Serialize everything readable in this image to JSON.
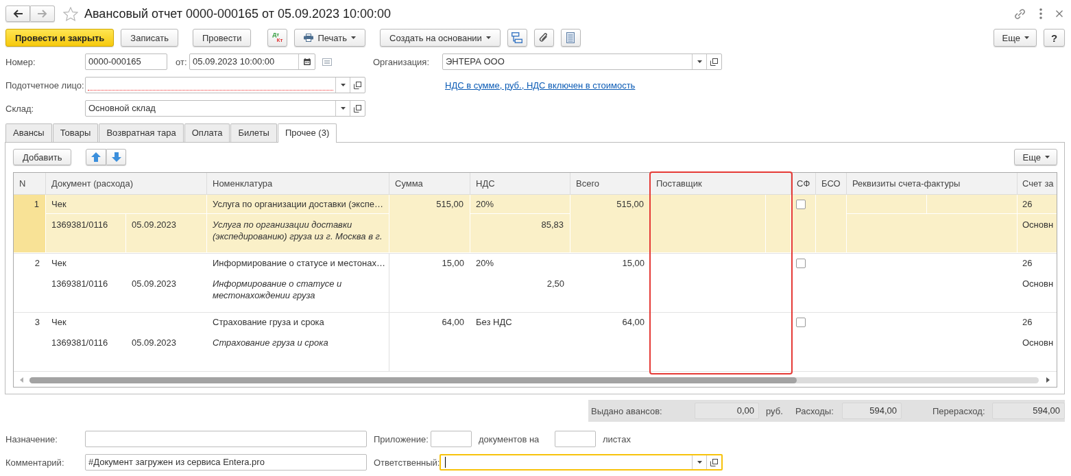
{
  "window": {
    "title": "Авансовый отчет 0000-000165 от 05.09.2023 10:00:00",
    "favorite": false
  },
  "navigation": {
    "can_go_back": true,
    "can_go_forward": false
  },
  "toolbar": {
    "post_and_close": "Провести и закрыть",
    "save": "Записать",
    "post": "Провести",
    "journal": {
      "debit": "Дт",
      "credit": "Кт"
    },
    "print": "Печать",
    "create_based_on": "Создать на основании",
    "more": "Еще",
    "help": "?"
  },
  "form": {
    "number": {
      "label": "Номер:",
      "value": "0000-000165"
    },
    "date": {
      "label": "от:",
      "value": "05.09.2023 10:00:00"
    },
    "organization": {
      "label": "Организация:",
      "value": "ЭНТЕРА ООО"
    },
    "accountable_person": {
      "label": "Подотчетное лицо:",
      "required": true
    },
    "vat_link": "НДС в сумме, руб., НДС включен в стоимость",
    "warehouse": {
      "label": "Склад:",
      "value": "Основной склад"
    }
  },
  "tabs": [
    {
      "label": "Авансы",
      "selected": false
    },
    {
      "label": "Товары",
      "selected": false
    },
    {
      "label": "Возвратная тара",
      "selected": false
    },
    {
      "label": "Оплата",
      "selected": false
    },
    {
      "label": "Билеты",
      "selected": false
    },
    {
      "label": "Прочее (3)",
      "selected": true
    }
  ],
  "table_toolbar": {
    "add": "Добавить",
    "more": "Еще"
  },
  "table": {
    "columns": [
      {
        "label": "N",
        "highlighted": false
      },
      {
        "label": "Документ (расхода)",
        "highlighted": false
      },
      {
        "label": "Номенклатура",
        "highlighted": false
      },
      {
        "label": "Сумма",
        "highlighted": false
      },
      {
        "label": "НДС",
        "highlighted": false
      },
      {
        "label": "Всего",
        "highlighted": false
      },
      {
        "label": "Поставщик",
        "highlighted": true
      },
      {
        "label": "СФ",
        "highlighted": false
      },
      {
        "label": "БСО",
        "highlighted": false
      },
      {
        "label": "Реквизиты счета-фактуры",
        "highlighted": false
      },
      {
        "label": "Счет за",
        "highlighted": false
      }
    ],
    "rows": [
      {
        "n": "1",
        "selected": true,
        "doc_type": "Чек",
        "doc_number": "1369381/0116",
        "doc_date": "05.09.2023",
        "item": "Услуга по организации доставки (экспе…",
        "item_description": "Услуга по организации доставки (экспедированию) груза из г. Москва в г.",
        "amount": "515,00",
        "vat_rate": "20%",
        "vat_amount": "85,83",
        "total": "515,00",
        "invoice": false,
        "account": "26",
        "account_detail": "Основн"
      },
      {
        "n": "2",
        "selected": false,
        "doc_type": "Чек",
        "doc_number": "1369381/0116",
        "doc_date": "05.09.2023",
        "item": "Информирование о статусе и местонах…",
        "item_description": "Информирование о статусе и местонахождении груза",
        "amount": "15,00",
        "vat_rate": "20%",
        "vat_amount": "2,50",
        "total": "15,00",
        "invoice": false,
        "account": "26",
        "account_detail": "Основн"
      },
      {
        "n": "3",
        "selected": false,
        "doc_type": "Чек",
        "doc_number": "1369381/0116",
        "doc_date": "05.09.2023",
        "item": "Страхование груза и срока",
        "item_description": "Страхование груза и срока",
        "amount": "64,00",
        "vat_rate": "Без НДС",
        "total": "64,00",
        "invoice": false,
        "account": "26",
        "account_detail": "Основн"
      }
    ]
  },
  "totals": {
    "advances": {
      "label": "Выдано авансов:",
      "value": "0,00",
      "unit": "руб."
    },
    "expenses": {
      "label": "Расходы:",
      "value": "594,00"
    },
    "overspend": {
      "label": "Перерасход:",
      "value": "594,00"
    }
  },
  "footer": {
    "purpose": {
      "label": "Назначение:"
    },
    "attachment": {
      "label": "Приложение:",
      "unit": "документов на"
    },
    "sheets": {
      "unit": "листах"
    },
    "comment": {
      "label": "Комментарий:",
      "value": "#Документ загружен из сервиса Entera.pro"
    },
    "responsible": {
      "label": "Ответственный:",
      "focused": true
    }
  }
}
